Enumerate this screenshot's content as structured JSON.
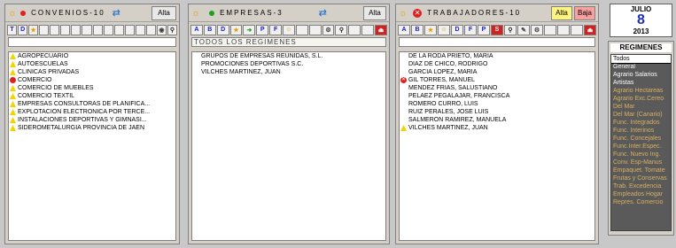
{
  "convenios": {
    "title": "CONVENIOS-10",
    "alta_label": "Alta",
    "toolbar": [
      "T",
      "D"
    ],
    "rows": [
      {
        "icon": "warning",
        "text": "AGROPECUARIO"
      },
      {
        "icon": "warning",
        "text": "AUTOESCUELAS"
      },
      {
        "icon": "warning",
        "text": "CLINICAS PRIVADAS"
      },
      {
        "icon": "dot",
        "text": "COMERCIO"
      },
      {
        "icon": "warning",
        "text": "COMERCIO DE MUEBLES"
      },
      {
        "icon": "warning",
        "text": "COMERCIO TEXTIL"
      },
      {
        "icon": "warning",
        "text": "EMPRESAS CONSULTORAS DE PLANIFICA..."
      },
      {
        "icon": "warning",
        "text": "EXPLOTACION ELECTRONICA POR TERCE..."
      },
      {
        "icon": "warning",
        "text": "INSTALACIONES DEPORTIVAS Y GIMNASI..."
      },
      {
        "icon": "warning",
        "text": "SIDEROMETALURGIA PROVINCIA DE JAEN"
      }
    ]
  },
  "empresas": {
    "title": "EMPRESAS-3",
    "alta_label": "Alta",
    "toolbar": [
      "A",
      "B",
      "D",
      "P",
      "F"
    ],
    "filter_text": "TODOS LOS REGIMENES",
    "rows": [
      {
        "text": "GRUPOS DE EMPRESAS REUNIDAS, S.L."
      },
      {
        "text": "PROMOCIONES DEPORTIVAS S.C."
      },
      {
        "text": "VILCHES MARTINEZ, JUAN"
      }
    ]
  },
  "trabajadores": {
    "title": "TRABAJADORES-10",
    "alta_label": "Alta",
    "baja_label": "Baja",
    "toolbar": [
      "A",
      "B",
      "D",
      "F",
      "P",
      "S"
    ],
    "rows": [
      {
        "icon": "",
        "text": "DE LA RODA PRIETO, MARIA"
      },
      {
        "icon": "",
        "text": "DIAZ DE CHICO, RODRIGO"
      },
      {
        "icon": "",
        "text": "GARCIA LOPEZ, MARIA"
      },
      {
        "icon": "x",
        "text": "GIL TORRES, MANUEL"
      },
      {
        "icon": "",
        "text": "MENDEZ FRIAS, SALUSTIANO"
      },
      {
        "icon": "",
        "text": "PELAEZ PEGALAJAR, FRANCISCA"
      },
      {
        "icon": "",
        "text": "ROMERO CURRO, LUIS"
      },
      {
        "icon": "",
        "text": "RUIZ PERALES, JOSE LUIS"
      },
      {
        "icon": "",
        "text": "SALMERON RAMIREZ, MANUELA"
      },
      {
        "icon": "warning",
        "text": "VILCHES MARTINEZ, JUAN"
      }
    ]
  },
  "calendar": {
    "month": "JULIO",
    "day": "8",
    "year": "2013"
  },
  "regimenes": {
    "title": "REGIMENES",
    "items": [
      {
        "text": "Todos",
        "style": "active"
      },
      {
        "text": "General",
        "style": "light"
      },
      {
        "text": "Agrario Salarios",
        "style": "light"
      },
      {
        "text": "Artistas",
        "style": "light"
      },
      {
        "text": "Agrario Hectareas",
        "style": ""
      },
      {
        "text": "Agrario Exc.Cereo",
        "style": ""
      },
      {
        "text": "Del Mar",
        "style": ""
      },
      {
        "text": "Del Mar (Canario)",
        "style": ""
      },
      {
        "text": "Func. Integrados",
        "style": ""
      },
      {
        "text": "Func. Interinos",
        "style": ""
      },
      {
        "text": "Func. Concejales",
        "style": ""
      },
      {
        "text": "Func.Inter.Espec.",
        "style": ""
      },
      {
        "text": "Func. Nuevo Ing.",
        "style": ""
      },
      {
        "text": "Conv. Esp-Manus",
        "style": ""
      },
      {
        "text": "Empaquet. Tomate",
        "style": ""
      },
      {
        "text": "Frutas y Conservas",
        "style": ""
      },
      {
        "text": "Trab. Excedencia",
        "style": ""
      },
      {
        "text": "Empleados Hogar",
        "style": ""
      },
      {
        "text": "Repres. Comercio",
        "style": ""
      }
    ]
  }
}
